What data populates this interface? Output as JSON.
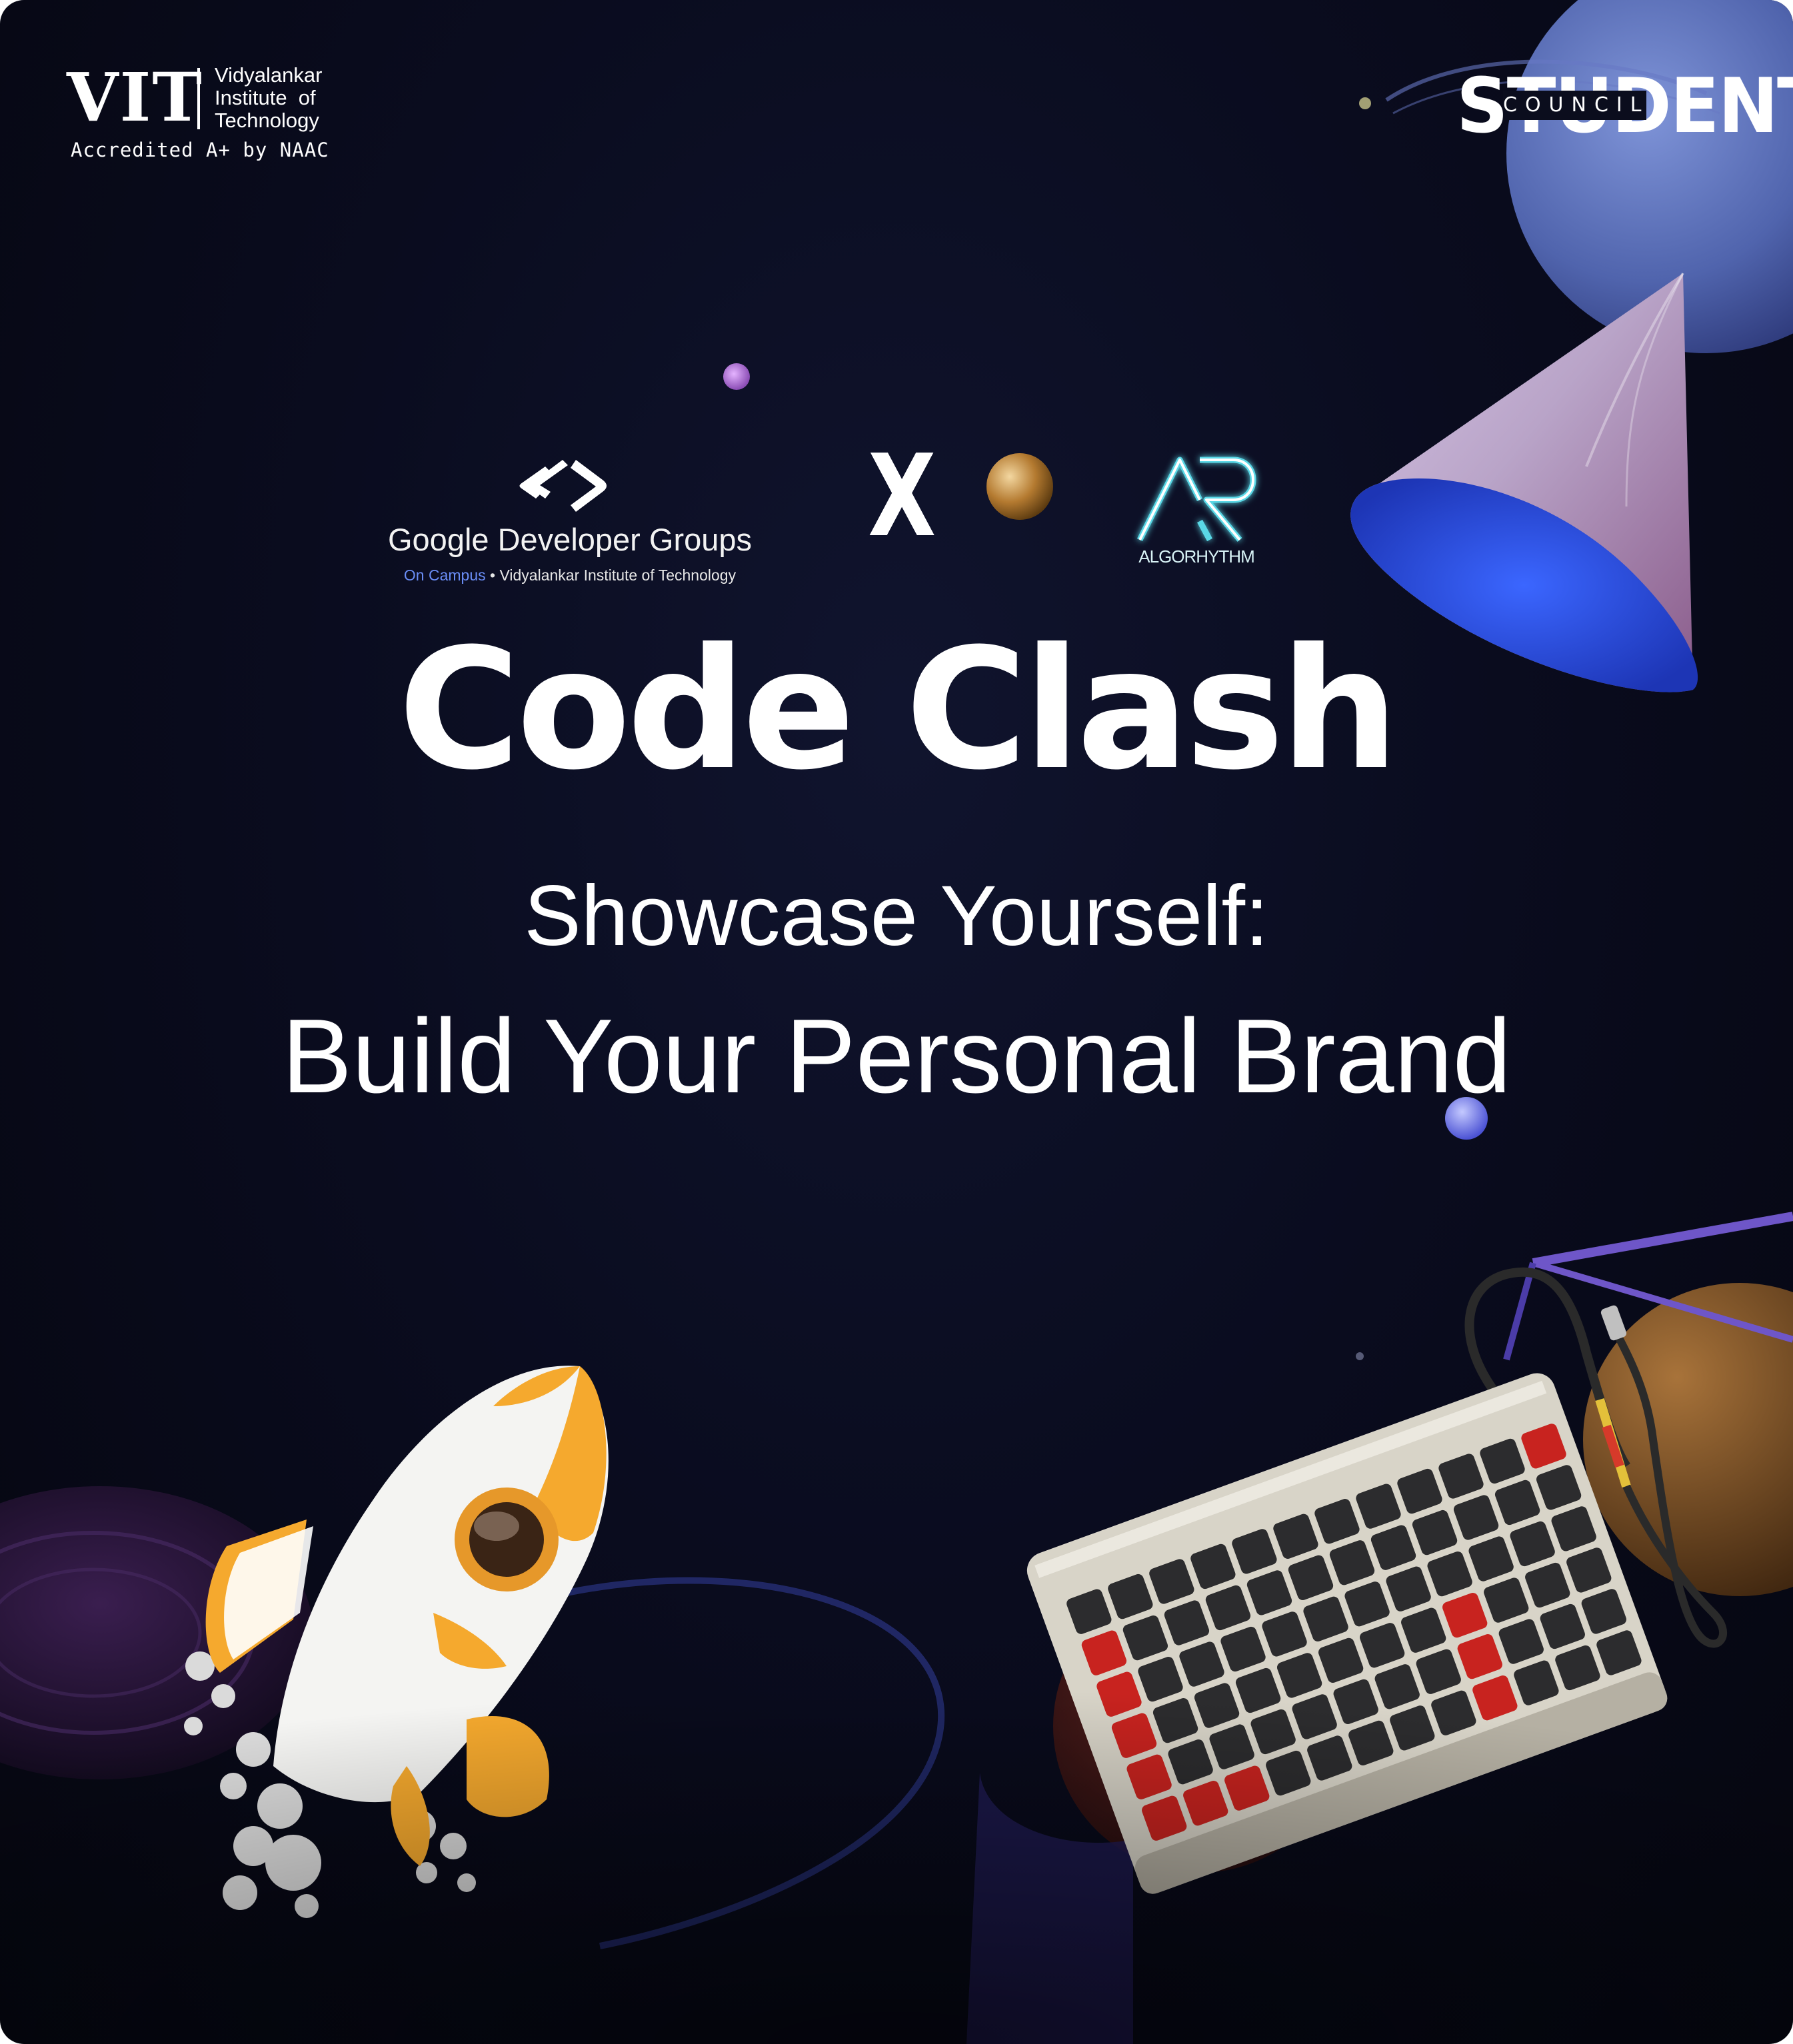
{
  "vit_logo": {
    "mark": "VIT",
    "name_lines": [
      "Vidyalankar",
      "Institute  of",
      "Technology"
    ],
    "accreditation": "Accredited A+ by NAAC"
  },
  "student_council_logo": {
    "word": "STUDENT",
    "subword": "COUNCIL"
  },
  "gdg_logo": {
    "icon": "gdg-brackets-icon",
    "title": "Google Developer Groups",
    "subtitle_prefix": "On Campus",
    "subtitle_rest": " • Vidyalankar Institute of Technology",
    "color_prefix": "#6a8df5"
  },
  "collab_mark": "X",
  "algorhythm_logo": {
    "icon": "ar-monogram-icon",
    "wordmark": "ALGORHYTHM",
    "glow_color": "#5ad8e6"
  },
  "event_title": "Code Clash",
  "subtitle_line1": "Showcase Yourself:",
  "subtitle_line2": "Build Your Personal Brand",
  "colors": {
    "background": "#0a0c1f",
    "text": "#ffffff",
    "rocket_accent": "#f2a72c",
    "keyboard_accent": "#c8231f"
  },
  "decorations": [
    "planet-icon",
    "cone-icon",
    "orb-icon",
    "rocket-icon",
    "keyboard-icon",
    "cable-icon"
  ]
}
